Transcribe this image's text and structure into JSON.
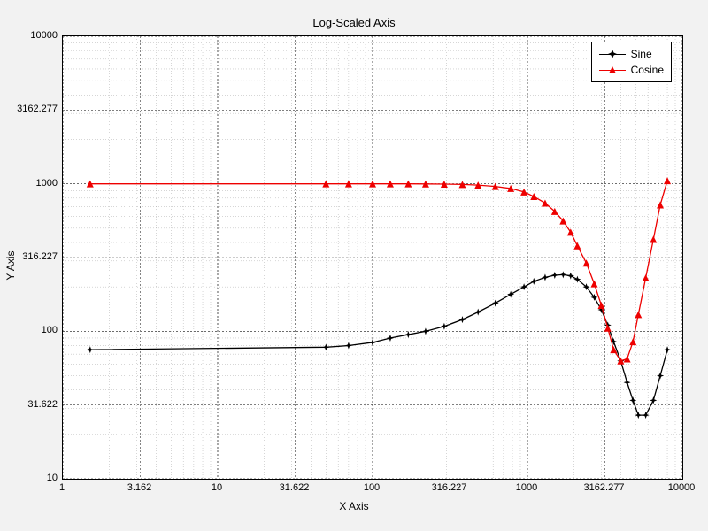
{
  "chart_data": {
    "type": "line",
    "title": "Log-Scaled Axis",
    "xlabel": "X Axis",
    "ylabel": "Y Axis",
    "x_scale": "log",
    "y_scale": "log",
    "xlim": [
      1,
      10000
    ],
    "ylim": [
      10,
      10000
    ],
    "x_ticks": [
      1,
      3.162,
      10,
      31.622,
      100,
      316.227,
      1000,
      3162.277,
      10000
    ],
    "x_tick_labels": [
      "1",
      "3.162",
      "10",
      "31.622",
      "100",
      "316.227",
      "1000",
      "3162.277",
      "10000"
    ],
    "y_ticks": [
      10,
      31.622,
      100,
      316.227,
      1000,
      3162.277,
      10000
    ],
    "y_tick_labels": [
      "10",
      "31.622",
      "100",
      "316.227",
      "1000",
      "3162.277",
      "10000"
    ],
    "series": [
      {
        "name": "Sine",
        "color": "#000000",
        "marker": "star",
        "x": [
          1.5,
          50,
          70,
          100,
          130,
          170,
          220,
          290,
          380,
          480,
          620,
          780,
          950,
          1100,
          1300,
          1500,
          1700,
          1900,
          2100,
          2400,
          2700,
          3000,
          3300,
          3600,
          4000,
          4400,
          4800,
          5200,
          5800,
          6500,
          7200,
          8000
        ],
        "y": [
          75,
          78,
          80,
          84,
          90,
          95,
          100,
          108,
          120,
          135,
          155,
          178,
          200,
          218,
          232,
          240,
          242,
          238,
          225,
          200,
          170,
          140,
          110,
          85,
          63,
          45,
          34,
          27,
          27,
          34,
          50,
          75
        ]
      },
      {
        "name": "Cosine",
        "color": "#ee0000",
        "marker": "triangle",
        "x": [
          1.5,
          50,
          70,
          100,
          130,
          170,
          220,
          290,
          380,
          480,
          620,
          780,
          950,
          1100,
          1300,
          1500,
          1700,
          1900,
          2100,
          2400,
          2700,
          3000,
          3300,
          3600,
          4000,
          4400,
          4800,
          5200,
          5800,
          6500,
          7200,
          8000
        ],
        "y": [
          1000,
          1000,
          1000,
          1000,
          1000,
          1000,
          998,
          995,
          990,
          980,
          960,
          930,
          880,
          820,
          740,
          650,
          560,
          470,
          380,
          290,
          210,
          150,
          105,
          75,
          63,
          65,
          85,
          130,
          230,
          420,
          720,
          1050
        ]
      }
    ],
    "legend": {
      "position": "upper-right",
      "entries": [
        "Sine",
        "Cosine"
      ]
    }
  },
  "colors": {
    "bg": "#f2f2f2",
    "plot_bg": "#ffffff",
    "grid": "#555555",
    "sine": "#000000",
    "cosine": "#ee0000"
  }
}
